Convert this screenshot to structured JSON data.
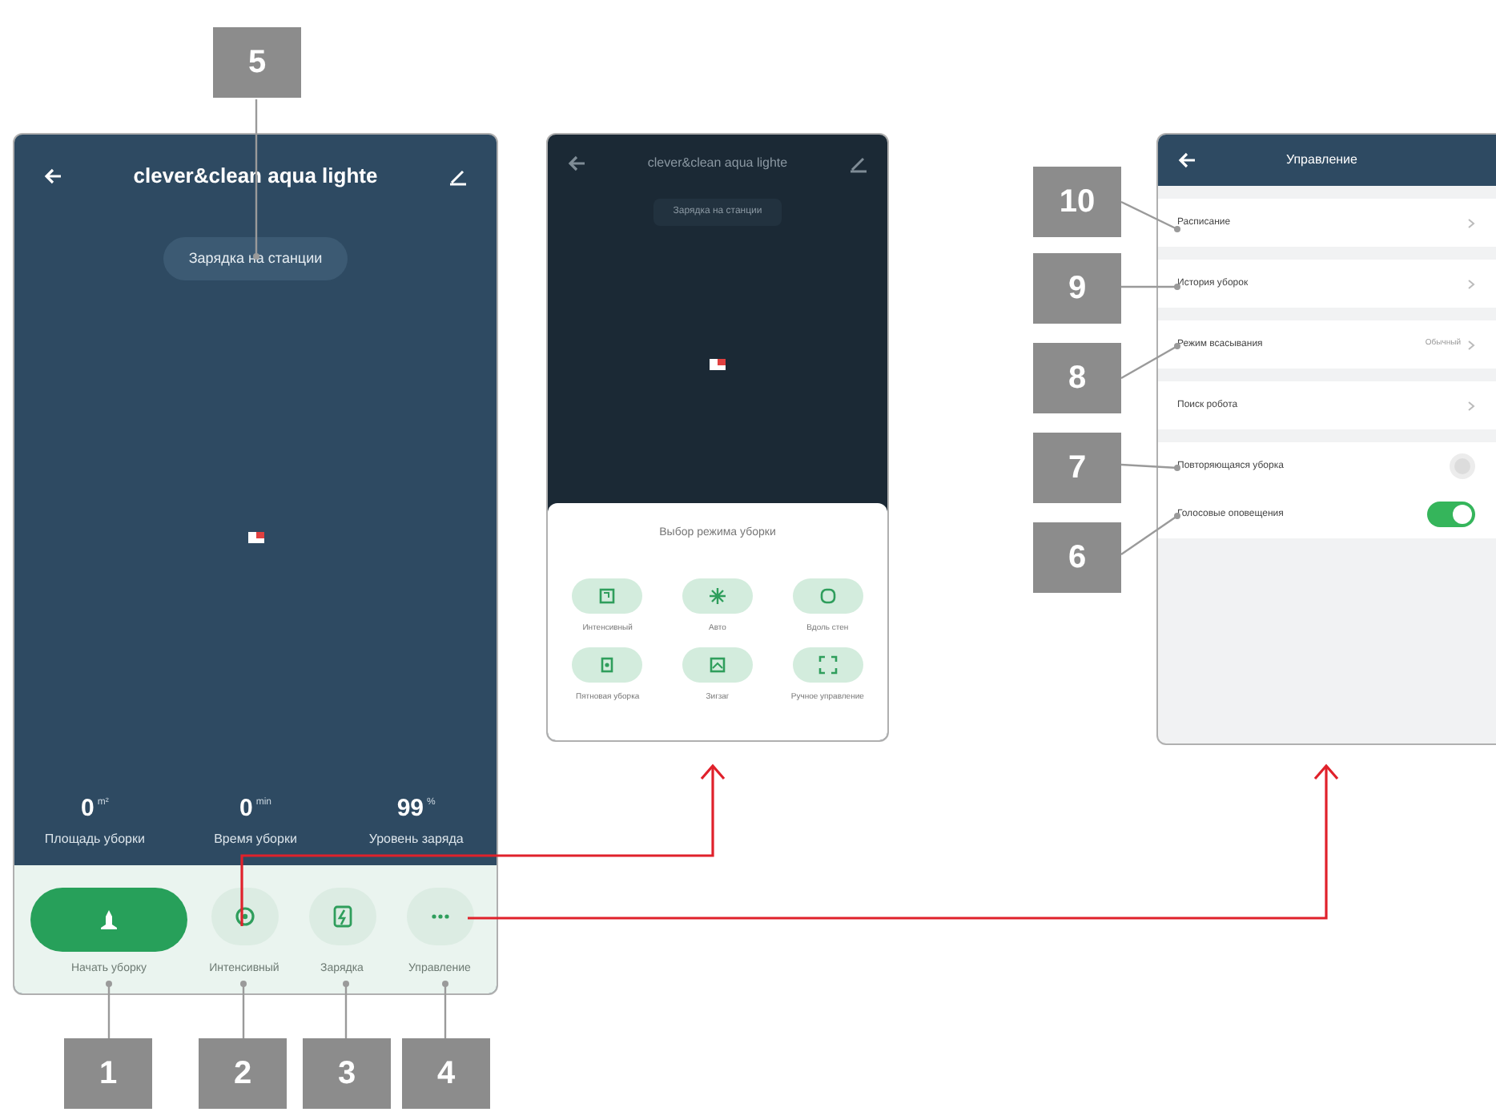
{
  "main_screen": {
    "title": "clever&clean aqua lighte",
    "status": "Зарядка на станции",
    "stats": [
      {
        "value": "0",
        "unit": "m²",
        "label": "Площадь уборки"
      },
      {
        "value": "0",
        "unit": "min",
        "label": "Время уборки"
      },
      {
        "value": "99",
        "unit": "%",
        "label": "Уровень заряда"
      }
    ],
    "actions": [
      {
        "kind": "start",
        "label": "Начать уборку"
      },
      {
        "kind": "mode",
        "label": "Интенсивный"
      },
      {
        "kind": "charge",
        "label": "Зарядка"
      },
      {
        "kind": "more",
        "label": "Управление"
      }
    ]
  },
  "mode_screen": {
    "title": "clever&clean aqua lighte",
    "status": "Зарядка на станции",
    "sheet_title": "Выбор режима уборки",
    "modes": [
      {
        "kind": "intense",
        "label": "Интенсивный"
      },
      {
        "kind": "auto",
        "label": "Авто"
      },
      {
        "kind": "edge",
        "label": "Вдоль стен"
      },
      {
        "kind": "spot",
        "label": "Пятновая уборка"
      },
      {
        "kind": "zigzag",
        "label": "Зигзаг"
      },
      {
        "kind": "manual",
        "label": "Ручное управление"
      }
    ]
  },
  "control_screen": {
    "title": "Управление",
    "items": [
      {
        "kind": "link",
        "label": "Расписание"
      },
      {
        "kind": "link",
        "label": "История уборок"
      },
      {
        "kind": "value",
        "label": "Режим всасывания",
        "value": "Обычный"
      },
      {
        "kind": "link",
        "label": "Поиск робота"
      },
      {
        "kind": "toggle",
        "label": "Повторяющаяся уборка",
        "on": false
      },
      {
        "kind": "toggle",
        "label": "Голосовые оповещения",
        "on": true
      }
    ]
  },
  "callouts": [
    "5",
    "10",
    "9",
    "8",
    "7",
    "6",
    "1",
    "2",
    "3",
    "4"
  ]
}
